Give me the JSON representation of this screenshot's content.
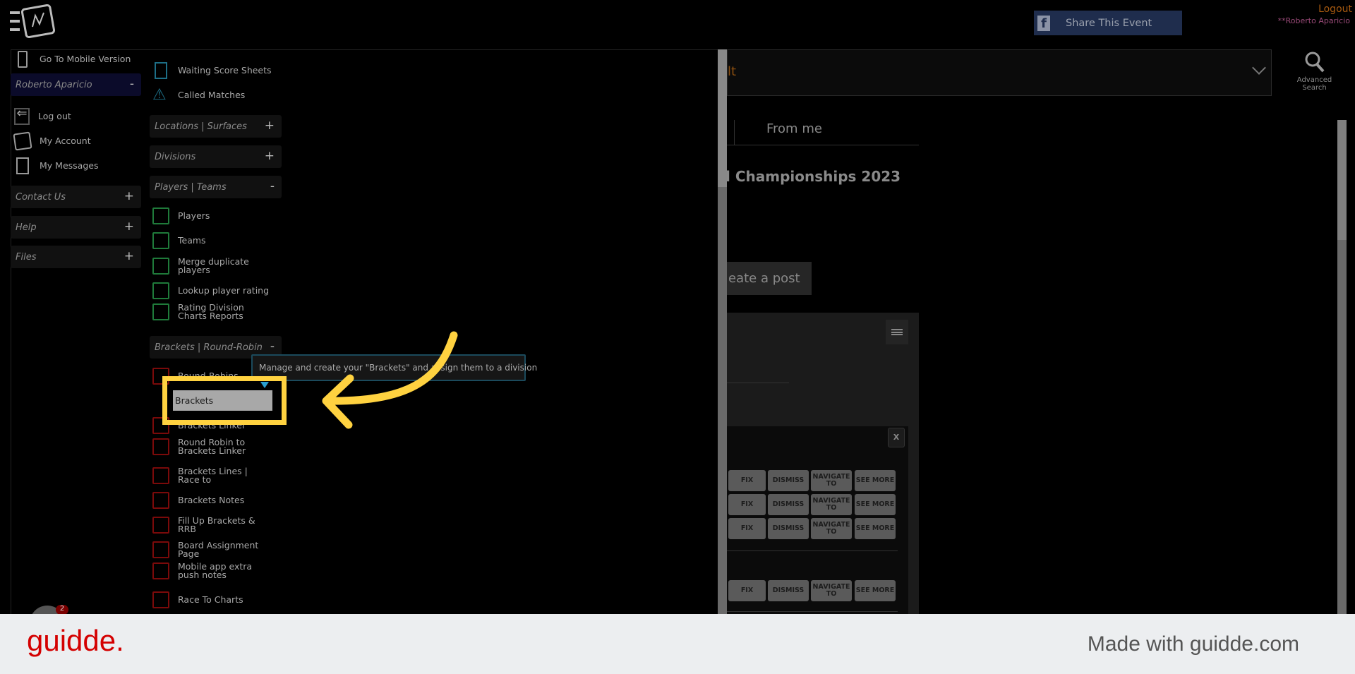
{
  "header": {
    "share_label": "Share This Event",
    "logout": "Logout",
    "user": "**Roberto Aparicio",
    "advanced_search": "Advanced Search"
  },
  "menu_left": {
    "mobile": "Go To Mobile Version",
    "user_section": "Roberto Aparicio",
    "items": [
      "Log out",
      "My Account",
      "My Messages"
    ],
    "sections": [
      "Contact Us",
      "Help",
      "Files"
    ]
  },
  "menu_right": {
    "top_items": [
      "Waiting Score Sheets",
      "Called Matches"
    ],
    "sections": {
      "locations": "Locations | Surfaces",
      "divisions": "Divisions",
      "players": "Players | Teams",
      "brackets": "Brackets | Round-Robin"
    },
    "player_items": [
      "Players",
      "Teams",
      "Merge duplicate players",
      "Lookup player rating",
      "Rating Division Charts Reports"
    ],
    "bracket_items": [
      "Round-Robins",
      "Brackets",
      "Brackets Linker",
      "Round Robin to Brackets Linker",
      "Brackets Lines | Race to",
      "Brackets Notes",
      "Fill Up Brackets & RRB",
      "Board Assignment Page",
      "Mobile app extra push notes",
      "Race To Charts"
    ]
  },
  "tooltip": "Manage and create your \"Brackets\" and assign them to a division",
  "main": {
    "dropdown_value": "lt",
    "tab": "From me",
    "event_title": "l Championships 2023",
    "create_post": "eate a post",
    "close": "X",
    "actions": {
      "fix": "FIX",
      "dismiss": "DISMISS",
      "navigate": "NAVIGATE TO",
      "see_more": "SEE MORE"
    }
  },
  "badge_count": "2",
  "footer": {
    "logo": "guidde.",
    "tagline": "Made with guidde.com"
  },
  "colors": {
    "highlight": "#ffd240",
    "accent_orange": "#c06a10",
    "brand_red": "#d40000",
    "facebook": "#1f2d4d"
  }
}
